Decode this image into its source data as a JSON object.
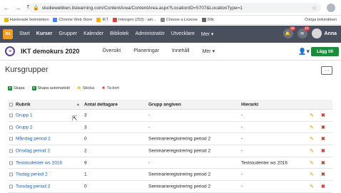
{
  "browser": {
    "url": "studiewebben.itslearning.com/ContentArea/ContentArea.aspx?LocationID=5707&LocationType=1",
    "bookmarks": [
      {
        "label": "Hanterade bokmärken",
        "color": "#f4b400"
      },
      {
        "label": "Chrome Web Store",
        "color": "#4285f4"
      },
      {
        "label": "IKT",
        "color": "#f4b400"
      },
      {
        "label": "Inkorgen (253) - am...",
        "color": "#db4437"
      },
      {
        "label": "Choose a License",
        "color": "#888888"
      },
      {
        "label": "50k",
        "color": "#666666"
      }
    ],
    "other_bookmarks": "Övriga bokmärken"
  },
  "mainnav": {
    "logo": "its",
    "items": [
      "Start",
      "Kurser",
      "Grupper",
      "Kalender",
      "Bibliotek",
      "Administratör",
      "Utvecklare",
      "Mer ▾"
    ],
    "active_index": 1,
    "notifications_badge": "40",
    "messages_badge": "10",
    "user_name": "Anna"
  },
  "course": {
    "title": "IKT demokurs 2020",
    "tabs": [
      "Översikt",
      "Planeringar",
      "Innehåll",
      "Mer ▾"
    ],
    "add_button": "Lägg till"
  },
  "page": {
    "title": "Kursgrupper",
    "more_button": "···"
  },
  "actions": [
    {
      "label": "Skapa",
      "icon": "plus-icon",
      "color": "#1f8a3a"
    },
    {
      "label": "Skapa automatiskt",
      "icon": "plus-icon",
      "color": "#1f8a3a"
    },
    {
      "label": "Skicka",
      "icon": "envelope-icon",
      "color": "#e0b000"
    },
    {
      "label": "Ta bort",
      "icon": "x-icon",
      "color": "#c0392b"
    }
  ],
  "table": {
    "headers": [
      "Rubrik",
      "Antal deltagare",
      "Grupp angiven",
      "Hierarki"
    ],
    "rows": [
      {
        "name": "Grupp 1",
        "count": "3",
        "group": "-",
        "hier": "-"
      },
      {
        "name": "Grupp 2",
        "count": "3",
        "group": "-",
        "hier": "-"
      },
      {
        "name": "Måndag period 2",
        "count": "0",
        "group": "Seminarieregistrering period 2",
        "hier": "-"
      },
      {
        "name": "Onsdag period 2",
        "count": "2",
        "group": "Seminarieregistrering period 2",
        "hier": "-"
      },
      {
        "name": "Teststudenter ws 2016",
        "count": "9",
        "group": "-",
        "hier": "Teststudenter ws 2016"
      },
      {
        "name": "Tisdag period 2",
        "count": "1",
        "group": "Seminarieregistrering period 2",
        "hier": "-"
      },
      {
        "name": "Torsdag period 2",
        "count": "0",
        "group": "Seminarieregistrering period 2",
        "hier": "-"
      }
    ]
  }
}
